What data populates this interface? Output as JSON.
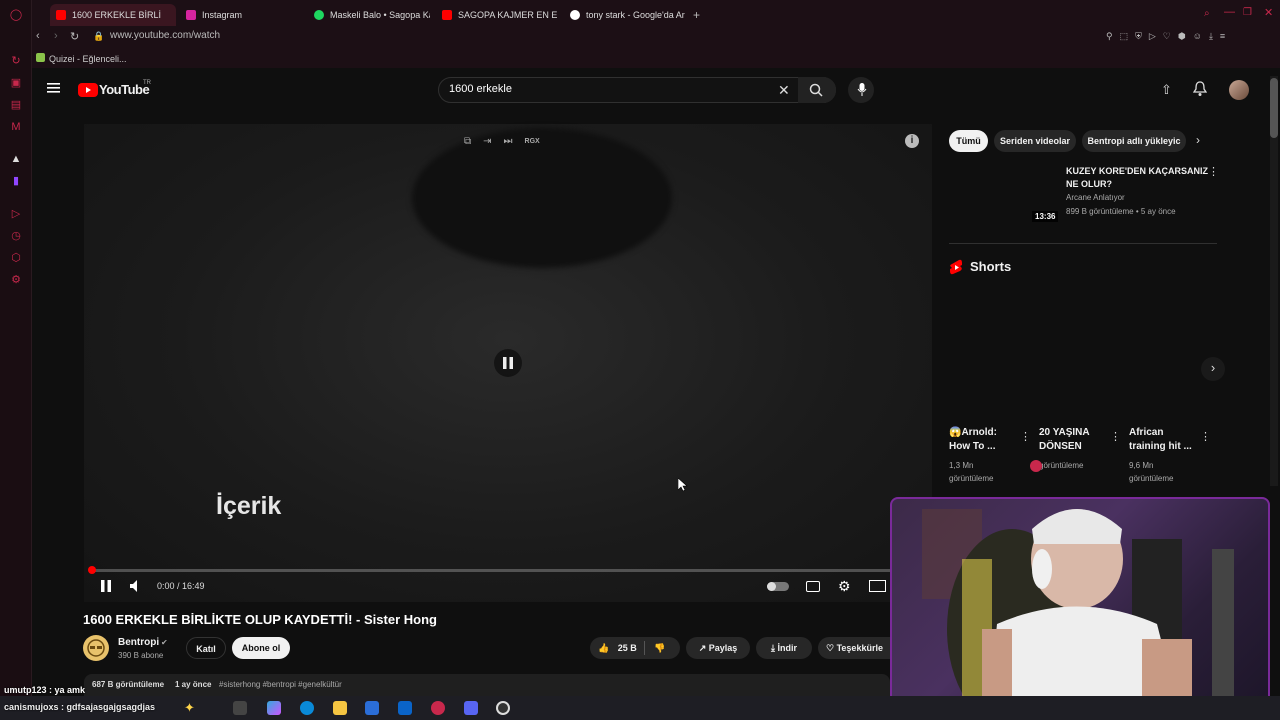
{
  "browser": {
    "tabs": [
      {
        "label": "1600 ERKEKLE BİRLİ",
        "color": "#ff0000"
      },
      {
        "label": "Instagram",
        "color": "#d6249f"
      },
      {
        "label": "Maskeli Balo • Sagopa Ka",
        "color": "#1ed760"
      },
      {
        "label": "SAGOPA KAJMER EN EFS",
        "color": "#ff0000"
      },
      {
        "label": "tony stark - Google'da Ar",
        "color": "#4285f4"
      }
    ],
    "url": "www.youtube.com/watch",
    "bookmark": "Quizei - Eğlenceli..."
  },
  "youtube": {
    "logo_text": "YouTube",
    "country": "TR",
    "search_value": "1600 erkekle",
    "player": {
      "overlay_text": "İçerik",
      "time": "0:00 / 16:49",
      "rgx": "RGX"
    },
    "video_title": "1600 ERKEKLE BİRLİKTE OLUP KAYDETTİ! - Sister Hong",
    "channel": {
      "name": "Bentropi",
      "subs": "390 B abone",
      "join": "Katıl",
      "subscribe": "Abone ol"
    },
    "actions": {
      "likes": "25 B",
      "share": "Paylaş",
      "download": "İndir",
      "thanks": "Teşekkürle"
    },
    "description": {
      "views": "687 B görüntüleme",
      "date": "1 ay önce",
      "tags": "#sisterhong #bentropi #genelkültür"
    },
    "chips": [
      "Tümü",
      "Seriden videolar",
      "Bentropi adlı yükleyic"
    ],
    "rec_video": {
      "title1": "KUZEY KORE'DEN KAÇARSANIZ",
      "title2": "NE OLUR?",
      "channel": "Arcane Anlatıyor",
      "meta": "899 B görüntüleme • 5 ay önce",
      "duration": "13:36"
    },
    "shorts_label": "Shorts",
    "shorts": [
      {
        "title1": "😱Arnold:",
        "title2": "How To ...",
        "views1": "1,3 Mn",
        "views2": "görüntüleme"
      },
      {
        "title1": "20 YAŞINA",
        "title2": "DÖNSEN",
        "views1": "",
        "views2": "görüntüleme"
      },
      {
        "title1": "African",
        "title2": "training hit ...",
        "views1": "9,6 Mn",
        "views2": "görüntüleme"
      }
    ]
  },
  "chat": {
    "line1": "umutp123 : ya amk",
    "line2": "canismujoxs : gdfsajasgajgsagdjas"
  },
  "colors": {
    "accent": "#ff0000",
    "opera": "#c8284c",
    "webcam_border": "#7a2a9a"
  }
}
